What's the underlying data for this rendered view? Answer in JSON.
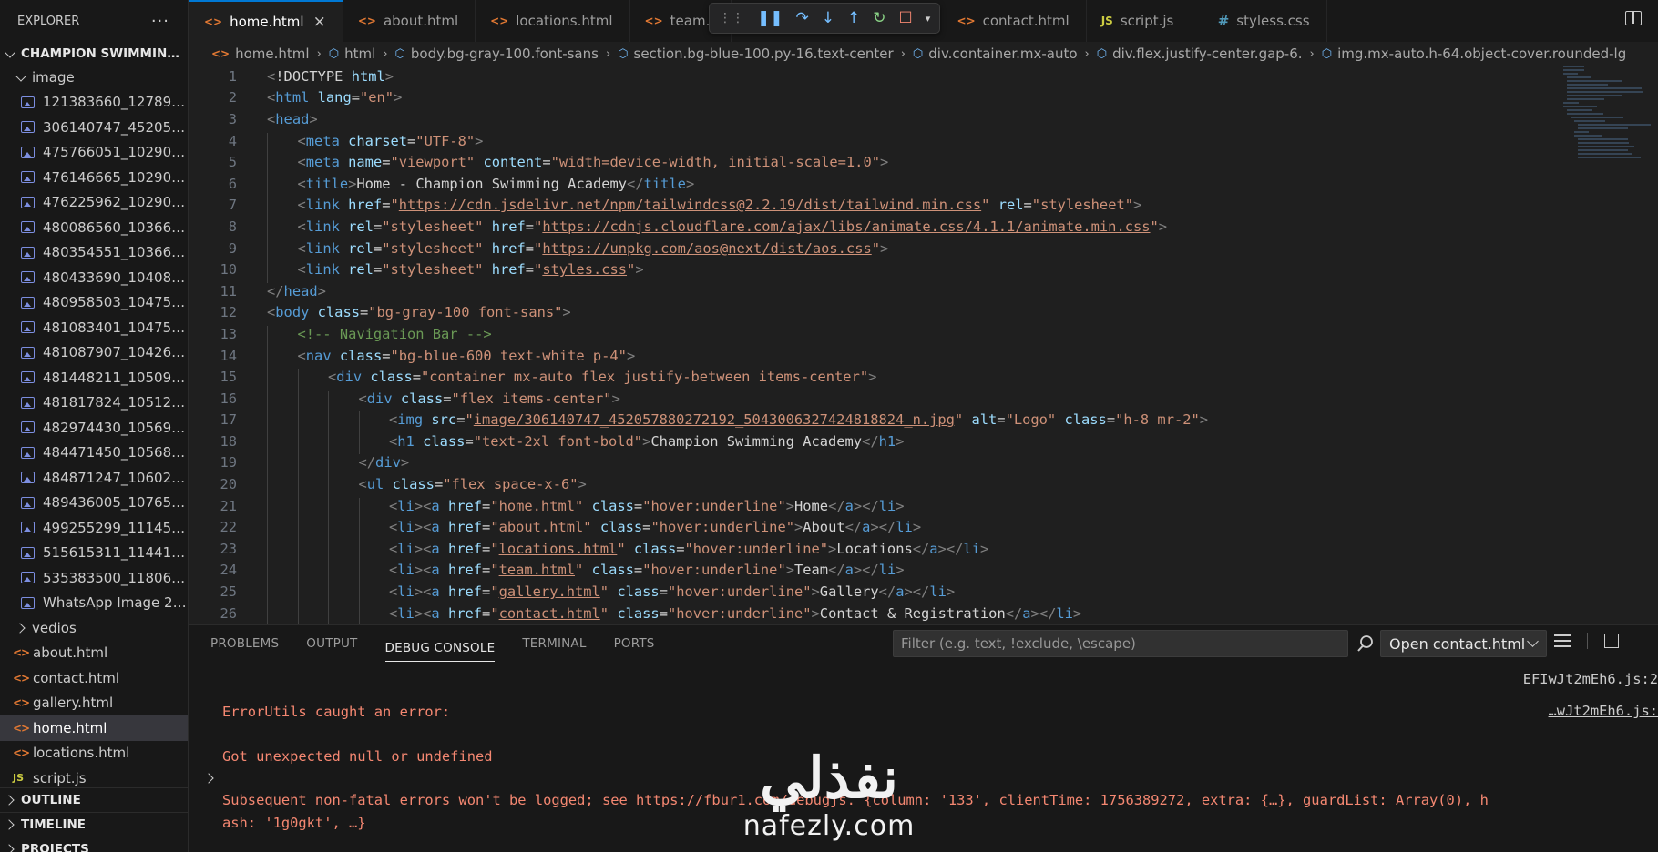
{
  "explorer": {
    "title": "EXPLORER",
    "more_icon": "ellipsis-icon",
    "project": "CHAMPION SWIMMING A...",
    "image_folder": "image",
    "image_files": [
      "121383660_1278907...",
      "306140747_4520578...",
      "475766051_1029092...",
      "476146665_1029092...",
      "476225962_1029092...",
      "480086560_1036665...",
      "480354551_1036665...",
      "480433690_1040890...",
      "480958503_1047537...",
      "481083401_1047537...",
      "481087907_1042690...",
      "481448211_1050922...",
      "481817824_1051212...",
      "482974430_1056973...",
      "484471450_1056814...",
      "484871247_1060292...",
      "489436005_1076502...",
      "499255299_1114524...",
      "515615311_1144155...",
      "535383500_1180695...",
      "WhatsApp Image 20..."
    ],
    "vedios_folder": "vedios",
    "files": [
      "about.html",
      "contact.html",
      "gallery.html",
      "home.html",
      "locations.html",
      "script.js"
    ],
    "outline": "OUTLINE",
    "timeline": "TIMELINE",
    "projects": "PROJECTS"
  },
  "tabs": [
    {
      "label": "home.html",
      "icon": "html",
      "active": true
    },
    {
      "label": "about.html",
      "icon": "html"
    },
    {
      "label": "locations.html",
      "icon": "html"
    },
    {
      "label": "team.l",
      "icon": "html"
    },
    {
      "label": "contact.html",
      "icon": "html"
    },
    {
      "label": "script.js",
      "icon": "js"
    },
    {
      "label": "styless.css",
      "icon": "css"
    }
  ],
  "breadcrumb": [
    "home.html",
    "html",
    "body.bg-gray-100.font-sans",
    "section.bg-blue-100.py-16.text-center",
    "div.container.mx-auto",
    "div.flex.justify-center.gap-6.",
    "img.mx-auto.h-64.object-cover.rounded-lg"
  ],
  "code": {
    "line_numbers": [
      "1",
      "2",
      "3",
      "4",
      "5",
      "6",
      "7",
      "8",
      "9",
      "10",
      "11",
      "12",
      "13",
      "14",
      "15",
      "16",
      "17",
      "18",
      "19",
      "20",
      "21",
      "22",
      "23",
      "24",
      "25",
      "26"
    ],
    "lines": [
      "<!DOCTYPE html>",
      "<html lang=\"en\">",
      "<head>",
      "<meta charset=\"UTF-8\">",
      "<meta name=\"viewport\" content=\"width=device-width, initial-scale=1.0\">",
      "<title>Home - Champion Swimming Academy</title>",
      "<link href=\"https://cdn.jsdelivr.net/npm/tailwindcss@2.2.19/dist/tailwind.min.css\" rel=\"stylesheet\">",
      "<link rel=\"stylesheet\" href=\"https://cdnjs.cloudflare.com/ajax/libs/animate.css/4.1.1/animate.min.css\">",
      "<link rel=\"stylesheet\" href=\"https://unpkg.com/aos@next/dist/aos.css\">",
      "<link rel=\"stylesheet\" href=\"styles.css\">",
      "</head>",
      "<body class=\"bg-gray-100 font-sans\">",
      "<!-- Navigation Bar -->",
      "<nav class=\"bg-blue-600 text-white p-4\">",
      "<div class=\"container mx-auto flex justify-between items-center\">",
      "<div class=\"flex items-center\">",
      "<img src=\"image/306140747_452057880272192_5043006327424818824_n.jpg\" alt=\"Logo\" class=\"h-8 mr-2\">",
      "<h1 class=\"text-2xl font-bold\">Champion Swimming Academy</h1>",
      "</div>",
      "<ul class=\"flex space-x-6\">",
      "<li><a href=\"home.html\" class=\"hover:underline\">Home</a></li>",
      "<li><a href=\"about.html\" class=\"hover:underline\">About</a></li>",
      "<li><a href=\"locations.html\" class=\"hover:underline\">Locations</a></li>",
      "<li><a href=\"team.html\" class=\"hover:underline\">Team</a></li>",
      "<li><a href=\"gallery.html\" class=\"hover:underline\">Gallery</a></li>",
      "<li><a href=\"contact.html\" class=\"hover:underline\">Contact & Registration</a></li>"
    ]
  },
  "panel": {
    "tabs": [
      "PROBLEMS",
      "OUTPUT",
      "DEBUG CONSOLE",
      "TERMINAL",
      "PORTS"
    ],
    "active_tab": "DEBUG CONSOLE",
    "filter_placeholder": "Filter (e.g. text, !exclude, \\escape)",
    "source_select": "Open contact.html",
    "console": {
      "link1": "EFIwJt2mEh6.js:2",
      "link2": "…wJt2mEh6.js:",
      "error1": "ErrorUtils caught an error:",
      "error2": "Got unexpected null or undefined",
      "error3a": "Subsequent non-fatal errors won't be logged; see https://fbur1.com/debugjs. {column: '133', clientTime: 1756389272, extra: {…}, guardList: Array(0), h",
      "error3b": "ash: '1g0gkt', …}"
    }
  },
  "watermark": {
    "arabic": "نفذلي",
    "latin": "nafezly.com"
  },
  "colors": {
    "accent": "#0078d4",
    "error": "#f48771",
    "sidebar_bg": "#181818",
    "editor_bg": "#1f1f1f"
  }
}
